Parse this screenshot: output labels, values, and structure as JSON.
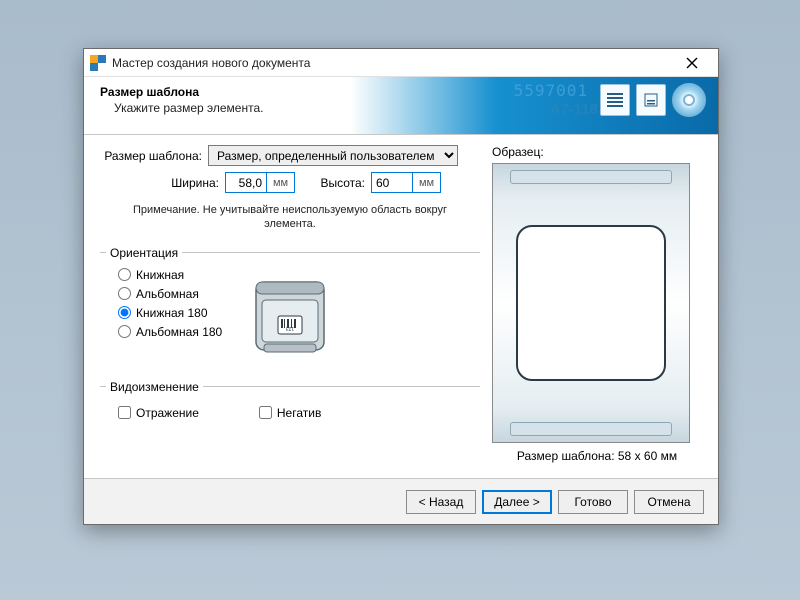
{
  "window": {
    "title": "Мастер создания нового документа"
  },
  "header": {
    "title": "Размер шаблона",
    "subtitle": "Укажите размер элемента.",
    "bg1": "5597001",
    "bg2": "A7-118"
  },
  "size": {
    "label": "Размер шаблона:",
    "dropdown_value": "Размер, определенный пользователем",
    "width_label": "Ширина:",
    "width_value": "58,0",
    "height_label": "Высота:",
    "height_value": "60",
    "unit": "мм",
    "note": "Примечание. Не учитывайте неиспользуемую область вокруг элемента."
  },
  "orientation": {
    "legend": "Ориентация",
    "options": [
      "Книжная",
      "Альбомная",
      "Книжная 180",
      "Альбомная 180"
    ],
    "selected_index": 2,
    "printer_label": "123"
  },
  "modification": {
    "legend": "Видоизменение",
    "mirror": "Отражение",
    "negative": "Негатив"
  },
  "sample": {
    "label": "Образец:",
    "caption": "Размер шаблона:  58 x 60 мм"
  },
  "buttons": {
    "back": "< Назад",
    "next": "Далее >",
    "finish": "Готово",
    "cancel": "Отмена"
  }
}
